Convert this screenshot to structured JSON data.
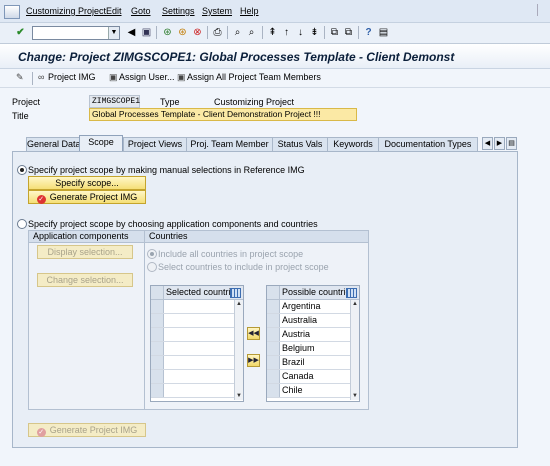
{
  "menubar": {
    "items": [
      "Customizing Project",
      "Edit",
      "Goto",
      "Settings",
      "System",
      "Help"
    ]
  },
  "toolbar": {
    "enter_icon": "check-icon",
    "command_field_value": ""
  },
  "header": {
    "title": "Change: Project ZIMGSCOPE1: Global Processes Template - Client Demonst"
  },
  "app_toolbar": {
    "project_img": "Project IMG",
    "assign_user": "Assign User...",
    "assign_all": "Assign All Project Team Members"
  },
  "fields": {
    "project_label": "Project",
    "project_value": "ZIMGSCOPE1",
    "type_label": "Type",
    "type_value": "Customizing Project",
    "title_label": "Title",
    "title_value": "Global Processes Template - Client Demonstration Project !!!"
  },
  "tabs": [
    "General Data",
    "Scope",
    "Project Views",
    "Proj. Team Member",
    "Status Vals",
    "Keywords",
    "Documentation Types"
  ],
  "scope": {
    "option1_label": "Specify project scope by making manual selections in Reference IMG",
    "specify_scope_button": "Specify scope...",
    "generate_button": "Generate Project IMG",
    "option2_label": "Specify project scope by choosing application components and countries",
    "app_components_header": "Application components",
    "display_selection_button": "Display selection...",
    "change_selection_button": "Change selection...",
    "countries_header": "Countries",
    "include_all_label": "Include all countries in project scope",
    "select_countries_label": "Select countries to include in project scope",
    "selected_countries_header": "Selected countries",
    "possible_countries_header": "Possible countries",
    "selected_countries": [
      "",
      "",
      "",
      "",
      "",
      "",
      ""
    ],
    "possible_countries": [
      "Argentina",
      "Australia",
      "Austria",
      "Belgium",
      "Brazil",
      "Canada",
      "Chile"
    ],
    "generate_button_bottom": "Generate Project IMG"
  }
}
